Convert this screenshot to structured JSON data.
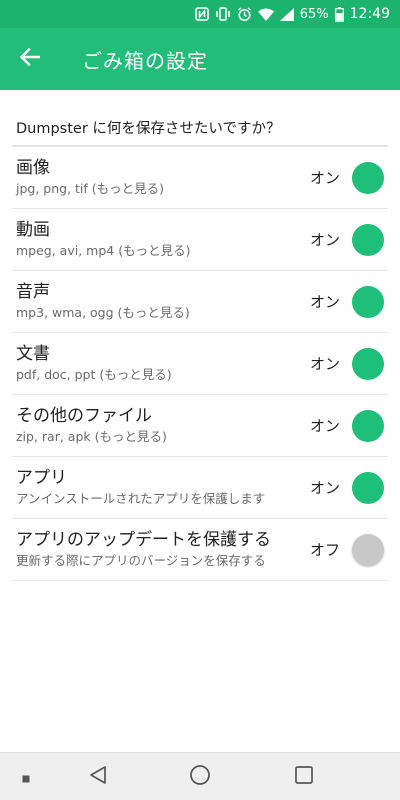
{
  "status_bar": {
    "battery": "65%",
    "time": "12:49",
    "icons": [
      "nfc-icon",
      "vibrate-icon",
      "alarm-icon",
      "wifi-icon",
      "signal-icon",
      "battery-icon"
    ]
  },
  "app_bar": {
    "title": "ごみ箱の設定",
    "back_icon": "arrow-left-icon"
  },
  "section": {
    "header": "Dumpster に何を保存させたいですか？"
  },
  "settings": [
    {
      "title": "画像",
      "subtitle": "jpg, png, tif (もっと見る)",
      "state": "オン",
      "on": true
    },
    {
      "title": "動画",
      "subtitle": "mpeg, avi, mp4 (もっと見る)",
      "state": "オン",
      "on": true
    },
    {
      "title": "音声",
      "subtitle": "mp3, wma, ogg (もっと見る)",
      "state": "オン",
      "on": true
    },
    {
      "title": "文書",
      "subtitle": "pdf, doc, ppt (もっと見る)",
      "state": "オン",
      "on": true
    },
    {
      "title": "その他のファイル",
      "subtitle": "zip, rar, apk (もっと見る)",
      "state": "オン",
      "on": true
    },
    {
      "title": "アプリ",
      "subtitle": "アンインストールされたアプリを保護します",
      "state": "オン",
      "on": true
    },
    {
      "title": "アプリのアップデートを保護する",
      "subtitle": "更新する際にアプリのバージョンを保存する",
      "state": "オフ",
      "on": false
    }
  ],
  "colors": {
    "status_bar": "#1cb36f",
    "app_bar": "#22bd79",
    "toggle_on": "#1ebf78",
    "toggle_off": "#c8c8c8"
  },
  "nav_bar": {
    "icons": [
      "recent-apps-dot-icon",
      "back-triangle-icon",
      "home-circle-icon",
      "overview-square-icon"
    ]
  }
}
